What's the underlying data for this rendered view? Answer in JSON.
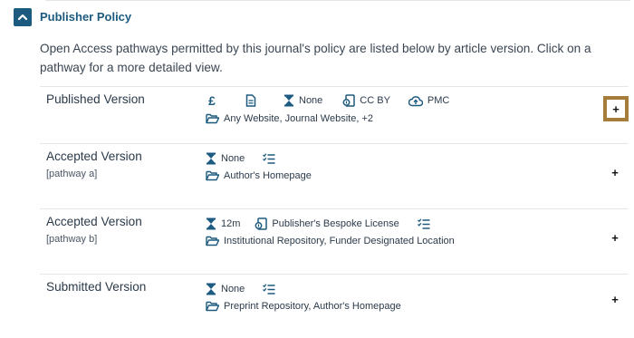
{
  "section": {
    "title": "Publisher Policy",
    "intro": "Open Access pathways permitted by this journal's policy are listed below by article version. Click on a pathway for a more detailed view."
  },
  "colors": {
    "accent": "#1d5a7f",
    "focus_outline": "#a67c3d",
    "divider": "#e3e6ea"
  },
  "pathways": [
    {
      "title": "Published Version",
      "subtitle": "",
      "embargo": "None",
      "license": "CC BY",
      "repository": "PMC",
      "locations": "Any Website, Journal Website, +2",
      "expand_label": "+"
    },
    {
      "title": "Accepted Version",
      "subtitle": "[pathway a]",
      "embargo": "None",
      "locations": "Author's Homepage",
      "expand_label": "+"
    },
    {
      "title": "Accepted Version",
      "subtitle": "[pathway b]",
      "embargo": "12m",
      "license": "Publisher's Bespoke License",
      "locations": "Institutional Repository, Funder Designated Location",
      "expand_label": "+"
    },
    {
      "title": "Submitted Version",
      "subtitle": "",
      "embargo": "None",
      "locations": "Preprint Repository, Author's Homepage",
      "expand_label": "+"
    }
  ],
  "icons": {
    "toggle": "chevron-up-icon",
    "fee": "pound-icon",
    "document": "document-icon",
    "embargo": "hourglass-icon",
    "license": "license-icon",
    "repository": "cloud-upload-icon",
    "conditions": "checklist-icon",
    "locations": "folder-open-icon"
  }
}
